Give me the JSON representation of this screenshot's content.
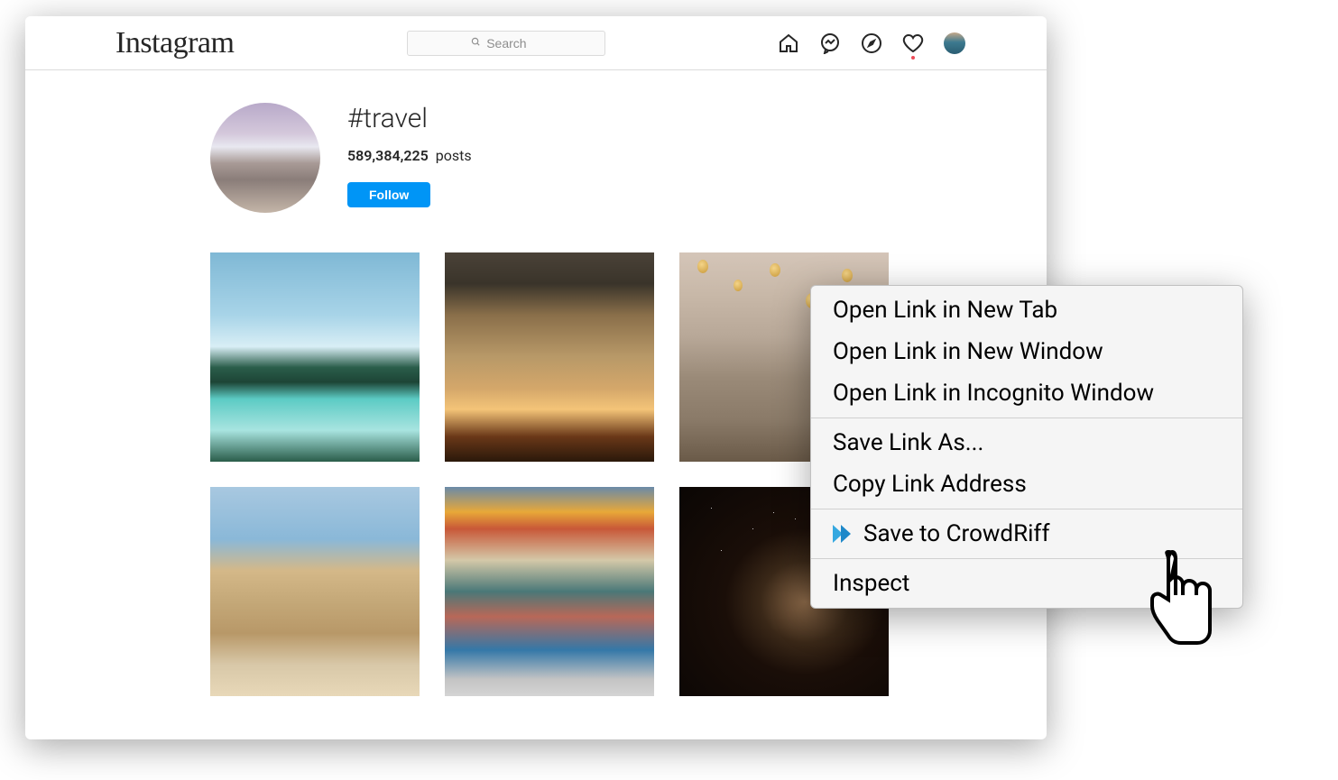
{
  "header": {
    "logo_text": "Instagram",
    "search_placeholder": "Search"
  },
  "profile": {
    "hashtag": "#travel",
    "post_count": "589,384,225",
    "posts_label": "posts",
    "follow_button": "Follow"
  },
  "context_menu": {
    "items": {
      "open_tab": "Open Link in New Tab",
      "open_window": "Open Link in New Window",
      "open_incognito": "Open Link in Incognito Window",
      "save_as": "Save Link As...",
      "copy_address": "Copy Link Address",
      "save_crowdriff": "Save to CrowdRiff",
      "inspect": "Inspect"
    }
  }
}
